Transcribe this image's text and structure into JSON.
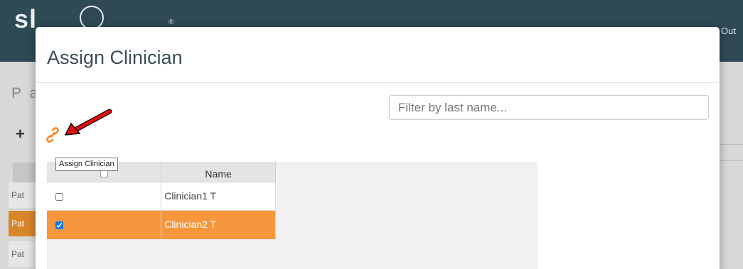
{
  "app": {
    "logo_text": "sl",
    "registered_mark": "®",
    "signout_fragment": "Out"
  },
  "background": {
    "page_title_fragment": "P a",
    "add_icon": "plus-icon",
    "rows": [
      "Pat",
      "Pat",
      "Pat"
    ]
  },
  "modal": {
    "title": "Assign Clinician",
    "filter": {
      "placeholder": "Filter by last name...",
      "value": ""
    },
    "assign_icon": "link-icon",
    "tooltip": "Assign Clinician",
    "annotation": "red-arrow",
    "table": {
      "columns": [
        "",
        "Name"
      ],
      "rows": [
        {
          "name": "Clinician1 T",
          "checked": false,
          "selected": false
        },
        {
          "name": "Clinician2 T",
          "checked": true,
          "selected": true
        }
      ]
    }
  },
  "colors": {
    "header": "#2f4a55",
    "accent_orange": "#f6973d",
    "link_icon": "#f08a2a",
    "arrow": "#e01010"
  }
}
